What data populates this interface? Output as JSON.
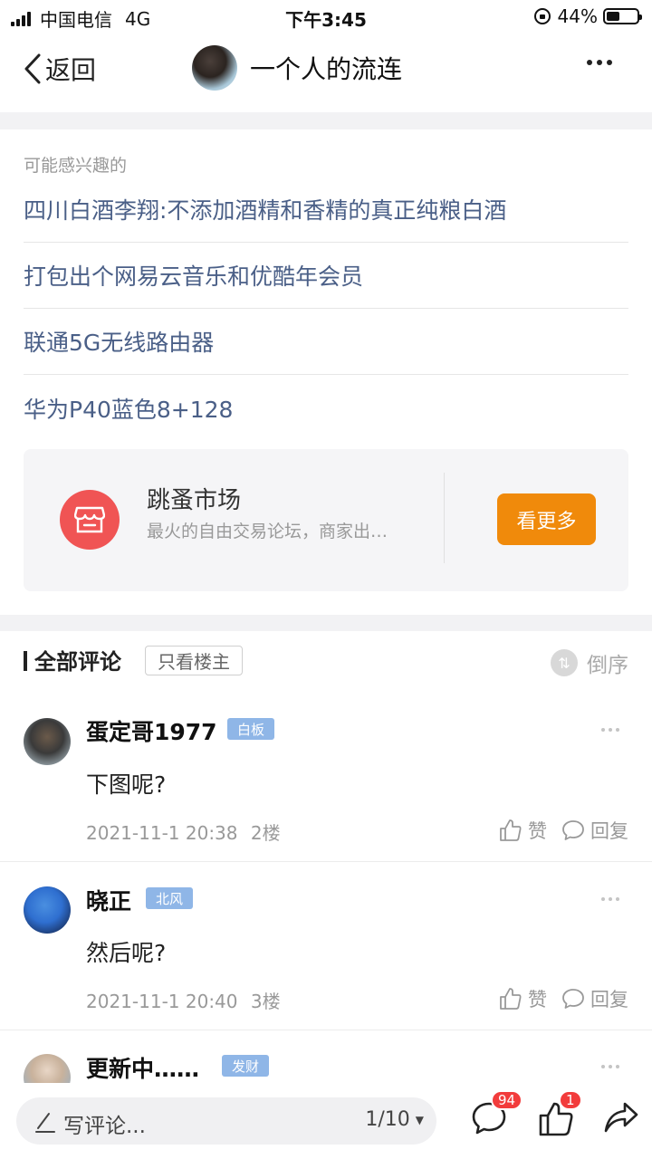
{
  "status_bar": {
    "carrier": "中国电信",
    "network": "4G",
    "time": "下午3:45",
    "battery": "44%",
    "battery_level": 0.44
  },
  "nav": {
    "back_label": "返回",
    "title": "一个人的流连",
    "more_icon": "more-horizontal-icon"
  },
  "recommend": {
    "heading": "可能感兴趣的",
    "items": [
      "四川白酒李翔:不添加酒精和香精的真正纯粮白酒",
      "打包出个网易云音乐和优酷年会员",
      "联通5G无线路由器",
      "华为P40蓝色8+128"
    ],
    "market": {
      "title": "跳蚤市场",
      "desc": "最火的自由交易论坛，商家出…",
      "button": "看更多",
      "icon": "shop-icon",
      "icon_color": "#f05454",
      "button_color": "#f08a0b"
    }
  },
  "comments_header": {
    "title": "全部评论",
    "filter": "只看楼主",
    "sort": "倒序"
  },
  "comments": [
    {
      "name": "蛋定哥1977",
      "badge": "白板",
      "text": "下图呢?",
      "date": "2021-11-1 20:38",
      "floor": "2楼",
      "like": "赞",
      "reply": "回复"
    },
    {
      "name": "晓正",
      "badge": "北风",
      "text": "然后呢?",
      "date": "2021-11-1 20:40",
      "floor": "3楼",
      "like": "赞",
      "reply": "回复"
    },
    {
      "name": "更新中……",
      "badge": "发财"
    }
  ],
  "bottom_bar": {
    "placeholder": "写评论...",
    "page": "1/10",
    "comment_count": "94",
    "like_count": "1"
  }
}
